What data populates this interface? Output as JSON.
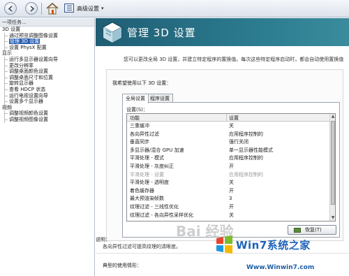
{
  "toolbar": {
    "back_icon": "back-arrow-icon",
    "forward_icon": "forward-arrow-icon",
    "home_icon": "home-icon",
    "view_icon": "grid-view-icon",
    "view_label": "高级设置"
  },
  "tree": {
    "header": "一项任务...",
    "items": [
      {
        "label": "3D 设置",
        "level": "category"
      },
      {
        "label": "通过预览调整图像设置",
        "level": "child"
      },
      {
        "label": "管理 3D 设置",
        "level": "child",
        "selected": true
      },
      {
        "label": "设置 PhysX 配置",
        "level": "child"
      },
      {
        "label": "显示",
        "level": "category"
      },
      {
        "label": "运行多显示器设置向导",
        "level": "child"
      },
      {
        "label": "更改分辨率",
        "level": "child"
      },
      {
        "label": "调整桌面颜色设置",
        "level": "child"
      },
      {
        "label": "调整桌面尺寸和位置",
        "level": "child"
      },
      {
        "label": "旋转显示器",
        "level": "child"
      },
      {
        "label": "查看 HDCP 状态",
        "level": "child"
      },
      {
        "label": "运行电视设置向导",
        "level": "child"
      },
      {
        "label": "设置多个显示器",
        "level": "child"
      },
      {
        "label": "视频",
        "level": "category"
      },
      {
        "label": "调整视频颜色设置",
        "level": "child"
      },
      {
        "label": "调整视频图像设置",
        "level": "child"
      }
    ]
  },
  "banner": {
    "title": "管理 3D 设置",
    "icon": "nvidia-3d-cube-icon"
  },
  "intro": "您可以更改全局 3D 设置，并建立特定程序的置换值。每次这些特定程序启动时，都会自动使用置换值",
  "prefer_label": "我希望使用以下 3D 设置：",
  "tabs": [
    "全局设置",
    "程序设置"
  ],
  "settings_label": "设置(S)：",
  "grid": {
    "col_feature": "功能",
    "col_setting": "设置",
    "rows": [
      {
        "feature": "三重缓冲",
        "setting": "关",
        "dim": false
      },
      {
        "feature": "各向异性过滤",
        "setting": "应用程序控制的",
        "dim": false
      },
      {
        "feature": "垂直同步",
        "setting": "强行关闭",
        "dim": false
      },
      {
        "feature": "多显示器/混合 GPU 加速",
        "setting": "单一显示器性能模式",
        "dim": false
      },
      {
        "feature": "平滑处理 - 模式",
        "setting": "应用程序控制的",
        "dim": false
      },
      {
        "feature": "平滑处理 - 灰度纠正",
        "setting": "开",
        "dim": false
      },
      {
        "feature": "平滑处理 - 设置",
        "setting": "应用程序控制的",
        "dim": true
      },
      {
        "feature": "平滑处理 - 透明度",
        "setting": "关",
        "dim": false
      },
      {
        "feature": "着色缓存器",
        "setting": "开",
        "dim": false
      },
      {
        "feature": "最大预渲染帧数",
        "setting": "3",
        "dim": false
      },
      {
        "feature": "纹理过滤 - 三线性优化",
        "setting": "开",
        "dim": false
      },
      {
        "feature": "纹理过滤 - 各向异性采样优化",
        "setting": "关",
        "dim": false
      }
    ]
  },
  "restore_label": "恢复(T)",
  "description_label": "说明：",
  "description_text": "各向异性过滤可提高纹理的清晰度。",
  "usage_label": "典型的使用情形：",
  "watermark": {
    "baidu": "Bai 经验",
    "brand": "Win7系统之家",
    "url": "Www.Winwin7.com"
  },
  "colors": {
    "banner": "#2b7a8e",
    "selection": "#2a5fb0",
    "watermark_blue": "#1e63b8"
  }
}
